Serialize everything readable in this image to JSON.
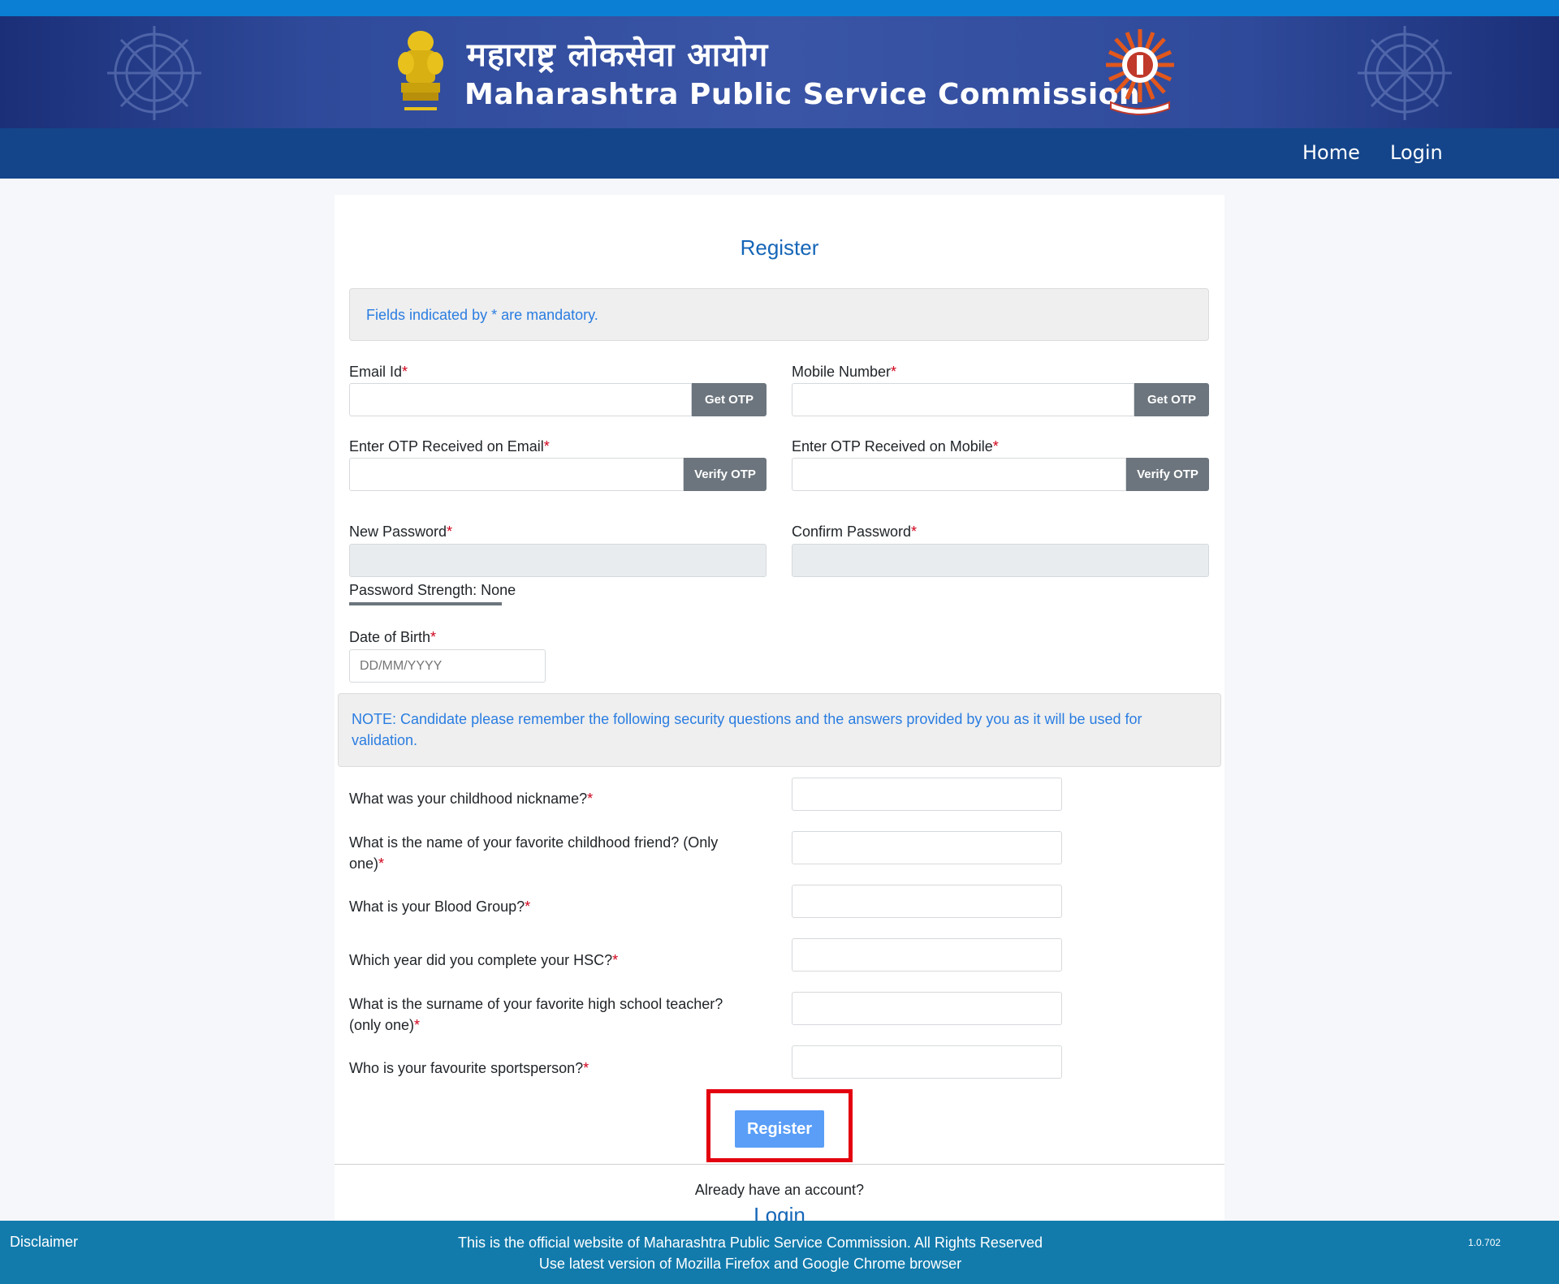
{
  "header": {
    "title_marathi": "महाराष्ट्र लोकसेवा आयोग",
    "title_english": "Maharashtra Public Service Commission"
  },
  "nav": {
    "home": "Home",
    "login": "Login"
  },
  "form": {
    "title": "Register",
    "mandatory_note": "Fields indicated by * are mandatory.",
    "email_label": "Email Id",
    "mobile_label": "Mobile Number",
    "get_otp": "Get OTP",
    "verify_otp": "Verify OTP",
    "email_otp_label": "Enter OTP Received on Email",
    "mobile_otp_label": "Enter OTP Received on Mobile",
    "new_password_label": "New Password",
    "confirm_password_label": "Confirm Password",
    "password_strength": "Password Strength: None",
    "dob_label": "Date of Birth",
    "dob_placeholder": "DD/MM/YYYY",
    "security_note": "NOTE: Candidate please remember the following security questions and the answers provided by you as it will be used for validation.",
    "asterisk": "*",
    "questions": [
      "What was your childhood nickname?",
      "What is the name of your favorite childhood friend? (Only one)",
      "What is your Blood Group?",
      "Which year did you complete your HSC?",
      "What is the surname of your favorite high school teacher? (only one)",
      "Who is your favourite sportsperson?"
    ],
    "register_button": "Register",
    "already_account": "Already have an account?",
    "login_link": "Login"
  },
  "footer": {
    "disclaimer": "Disclaimer",
    "line1": "This is the official website of Maharashtra Public Service Commission. All Rights Reserved",
    "line2": "Use latest version of Mozilla Firefox and Google Chrome browser",
    "version": "1.0.702"
  },
  "colors": {
    "navbar": "#14458a",
    "footer": "#127bac",
    "accent": "#1566b8",
    "required": "#d0021b",
    "register_button": "#5a9ef7",
    "highlight": "#e3000f"
  }
}
